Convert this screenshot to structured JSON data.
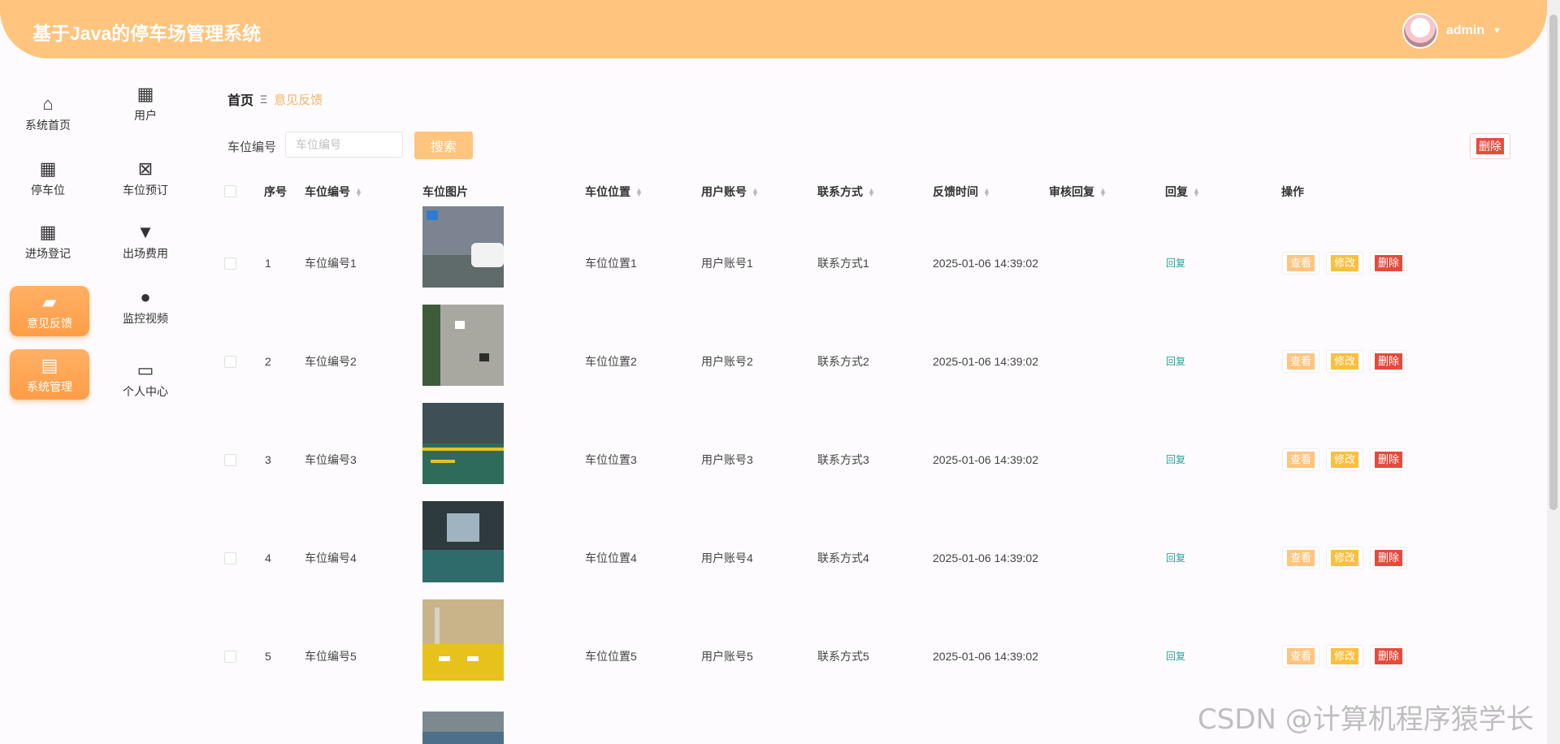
{
  "header": {
    "title": "基于Java的停车场管理系统",
    "username": "admin"
  },
  "menu": {
    "left": [
      {
        "label": "系统首页",
        "icon": "home-icon"
      },
      {
        "label": "停车位",
        "icon": "grid-icon"
      },
      {
        "label": "进场登记",
        "icon": "grid-icon"
      },
      {
        "label": "意见反馈",
        "icon": "wallet-icon",
        "active": true
      },
      {
        "label": "系统管理",
        "icon": "clipboard-icon",
        "active": true
      }
    ],
    "right": [
      {
        "label": "用户",
        "icon": "grid-icon"
      },
      {
        "label": "车位预订",
        "icon": "clipboard-x-icon"
      },
      {
        "label": "出场费用",
        "icon": "brush-icon"
      },
      {
        "label": "监控视频",
        "icon": "user-icon"
      },
      {
        "label": "个人中心",
        "icon": "card-icon"
      }
    ]
  },
  "breadcrumb": {
    "home": "首页",
    "separator": "Ξ",
    "current": "意见反馈"
  },
  "search": {
    "label": "车位编号",
    "placeholder": "车位编号",
    "button": "搜索"
  },
  "toolbar": {
    "delete_label": "删除"
  },
  "table": {
    "headers": [
      "序号",
      "车位编号",
      "车位图片",
      "车位位置",
      "用户账号",
      "联系方式",
      "反馈时间",
      "审核回复",
      "回复",
      "操作"
    ],
    "rows": [
      {
        "index": "1",
        "code": "车位编号1",
        "location": "车位位置1",
        "account": "用户账号1",
        "contact": "联系方式1",
        "time": "2025-01-06 14:39:02",
        "review": "",
        "reply": "回复"
      },
      {
        "index": "2",
        "code": "车位编号2",
        "location": "车位位置2",
        "account": "用户账号2",
        "contact": "联系方式2",
        "time": "2025-01-06 14:39:02",
        "review": "",
        "reply": "回复"
      },
      {
        "index": "3",
        "code": "车位编号3",
        "location": "车位位置3",
        "account": "用户账号3",
        "contact": "联系方式3",
        "time": "2025-01-06 14:39:02",
        "review": "",
        "reply": "回复"
      },
      {
        "index": "4",
        "code": "车位编号4",
        "location": "车位位置4",
        "account": "用户账号4",
        "contact": "联系方式4",
        "time": "2025-01-06 14:39:02",
        "review": "",
        "reply": "回复"
      },
      {
        "index": "5",
        "code": "车位编号5",
        "location": "车位位置5",
        "account": "用户账号5",
        "contact": "联系方式5",
        "time": "2025-01-06 14:39:02",
        "review": "",
        "reply": "回复"
      }
    ],
    "actions": {
      "view": "查看",
      "edit": "修改",
      "delete": "删除"
    }
  },
  "watermark": "CSDN @计算机程序猿学长"
}
